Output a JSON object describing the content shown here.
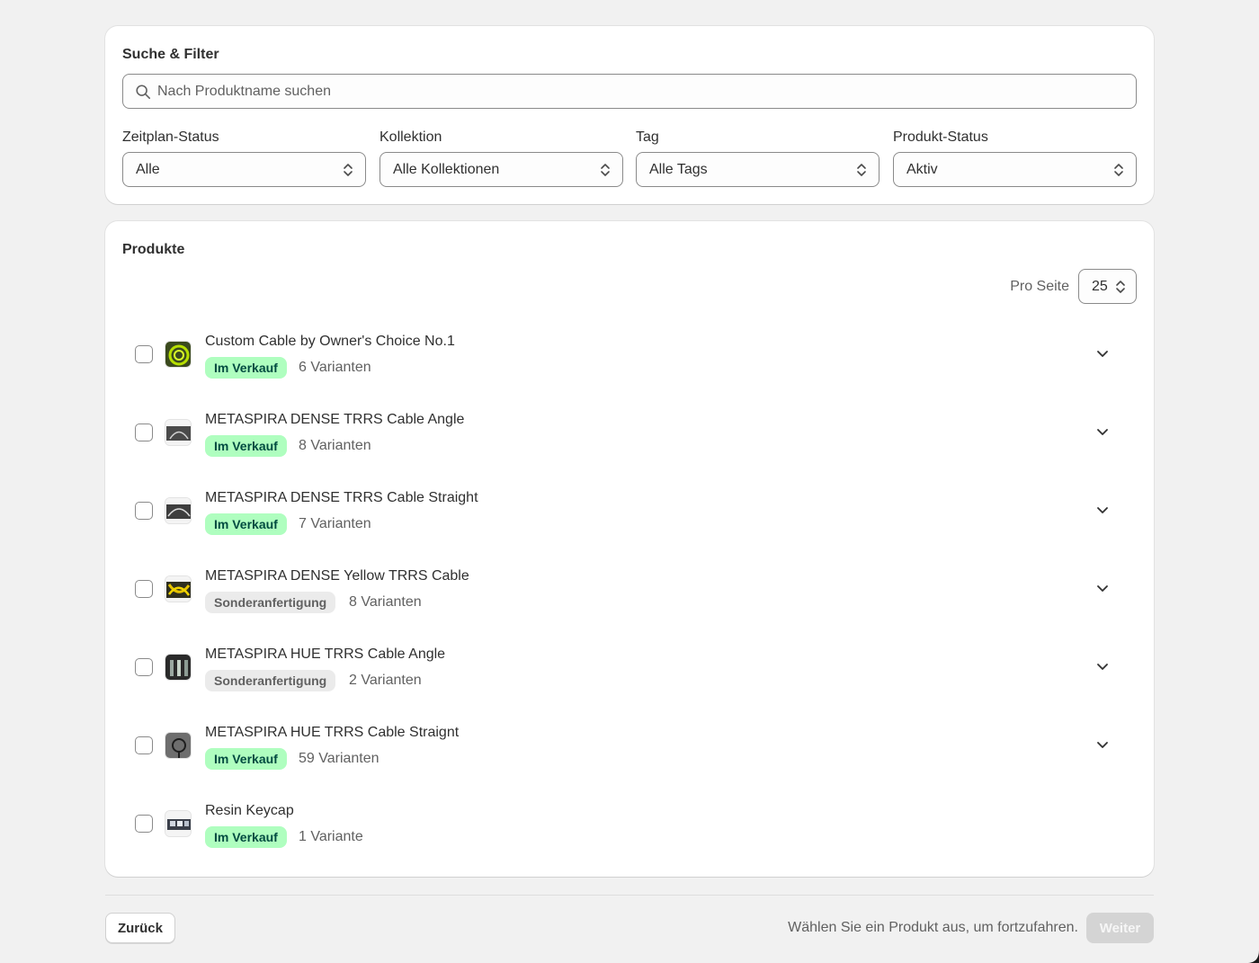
{
  "filters": {
    "title": "Suche & Filter",
    "search_placeholder": "Nach Produktname suchen",
    "schedule_status": {
      "label": "Zeitplan-Status",
      "value": "Alle"
    },
    "collection": {
      "label": "Kollektion",
      "value": "Alle Kollektionen"
    },
    "tag": {
      "label": "Tag",
      "value": "Alle Tags"
    },
    "product_status": {
      "label": "Produkt-Status",
      "value": "Aktiv"
    }
  },
  "products": {
    "title": "Produkte",
    "per_page_label": "Pro Seite",
    "per_page_value": "25",
    "items": [
      {
        "title": "Custom Cable by Owner's Choice No.1",
        "status": "Im Verkauf",
        "variants": "6 Varianten"
      },
      {
        "title": "METASPIRA DENSE TRRS Cable Angle",
        "status": "Im Verkauf",
        "variants": "8 Varianten"
      },
      {
        "title": "METASPIRA DENSE TRRS Cable Straight",
        "status": "Im Verkauf",
        "variants": "7 Varianten"
      },
      {
        "title": "METASPIRA DENSE Yellow TRRS Cable",
        "status": "Sonderanfertigung",
        "variants": "8 Varianten"
      },
      {
        "title": "METASPIRA HUE TRRS Cable Angle",
        "status": "Sonderanfertigung",
        "variants": "2 Varianten"
      },
      {
        "title": "METASPIRA HUE TRRS Cable Straignt",
        "status": "Im Verkauf",
        "variants": "59 Varianten"
      },
      {
        "title": "Resin Keycap",
        "status": "Im Verkauf",
        "variants": "1 Variante"
      }
    ]
  },
  "footer": {
    "back_label": "Zurück",
    "hint": "Wählen Sie ein Produkt aus, um fortzufahren.",
    "next_label": "Weiter"
  },
  "colors": {
    "badge_on_sale_bg": "#affebf",
    "badge_custom_bg": "#ebebeb",
    "next_disabled_bg": "#d4d4d4"
  }
}
